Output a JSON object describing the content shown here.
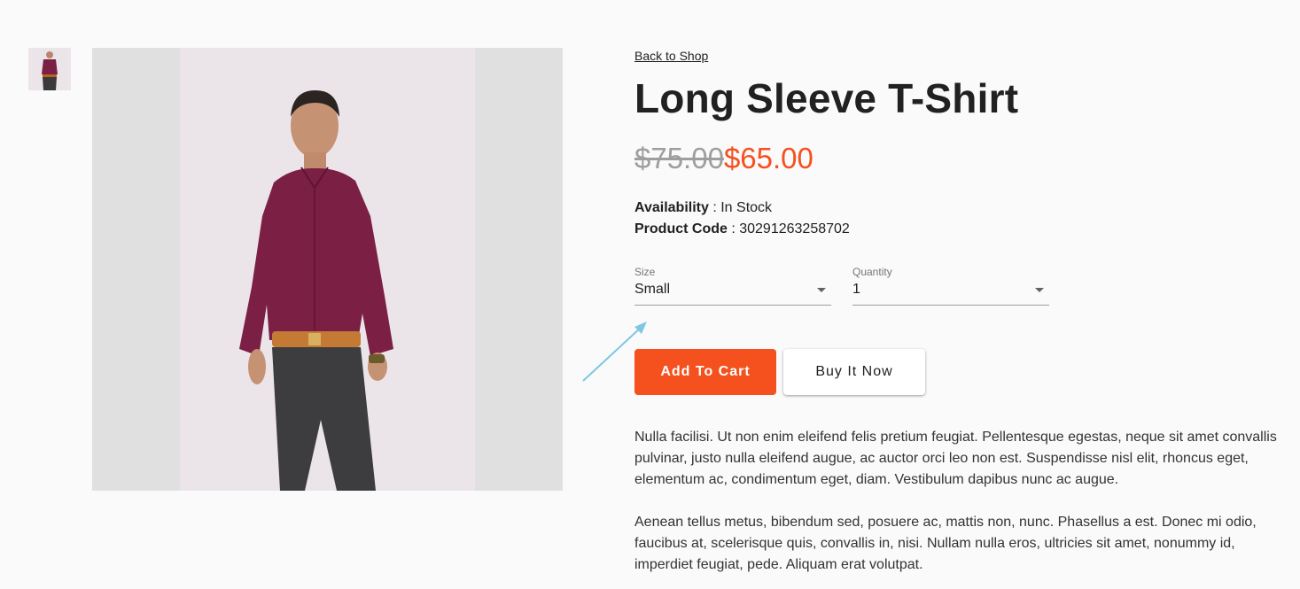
{
  "gallery": {
    "thumbnail_alt": "thumbnail-shirt-model",
    "main_image_alt": "main-product-photo"
  },
  "product": {
    "back_link": "Back to Shop",
    "title": "Long Sleeve T-Shirt",
    "old_price": "$75.00",
    "new_price": "$65.00",
    "availability_label": "Availability",
    "availability_value": " : In Stock",
    "code_label": "Product Code",
    "code_value": " : 30291263258702"
  },
  "options": {
    "size_label": "Size",
    "size_value": "Small",
    "quantity_label": "Quantity",
    "quantity_value": "1"
  },
  "buttons": {
    "add_to_cart": "Add To Cart",
    "buy_now": "Buy It Now"
  },
  "description": {
    "p1": "Nulla facilisi. Ut non enim eleifend felis pretium feugiat. Pellentesque egestas, neque sit amet convallis pulvinar, justo nulla eleifend augue, ac auctor orci leo non est. Suspendisse nisl elit, rhoncus eget, elementum ac, condimentum eget, diam. Vestibulum dapibus nunc ac augue.",
    "p2": "Aenean tellus metus, bibendum sed, posuere ac, mattis non, nunc. Phasellus a est. Donec mi odio, faucibus at, scelerisque quis, convallis in, nisi. Nullam nulla eros, ultricies sit amet, nonummy id, imperdiet feugiat, pede. Aliquam erat volutpat."
  },
  "colors": {
    "accent": "#f4511e",
    "shirt": "#7b1f45",
    "annotation_arrow": "#7ec8e3"
  }
}
